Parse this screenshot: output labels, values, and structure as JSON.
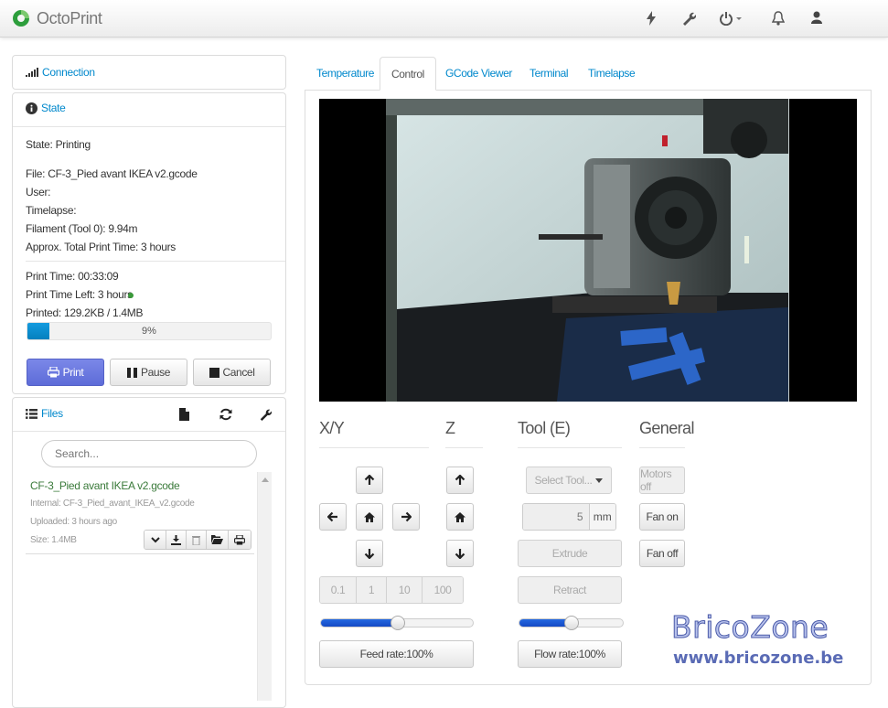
{
  "app": {
    "title": "OctoPrint"
  },
  "navbar": {
    "icons": [
      "lightning-icon",
      "wrench-icon",
      "power-icon",
      "bell-icon",
      "user-icon"
    ]
  },
  "connection": {
    "title": "Connection"
  },
  "state": {
    "title": "State",
    "status": "State: Printing",
    "file": "File: CF-3_Pied avant IKEA v2.gcode",
    "user": "User:",
    "timelapse": "Timelapse:",
    "filament": "Filament (Tool 0): 9.94m",
    "approx_time": "Approx. Total Print Time: 3 hours",
    "print_time": "Print Time: 00:33:09",
    "time_left": "Print Time Left: 3 hours",
    "printed": "Printed: 129.2KB / 1.4MB",
    "progress_label": "9%",
    "progress": 0.09,
    "buttons": {
      "print": "Print",
      "pause": "Pause",
      "cancel": "Cancel"
    }
  },
  "files": {
    "title": "Files",
    "search_placeholder": "Search...",
    "item": {
      "name": "CF-3_Pied avant IKEA v2.gcode",
      "internal": "Internal: CF-3_Pied_avant_IKEA_v2.gcode",
      "uploaded": "Uploaded: 3 hours ago",
      "size": "Size: 1.4MB"
    }
  },
  "tabs": [
    "Temperature",
    "Control",
    "GCode Viewer",
    "Terminal",
    "Timelapse"
  ],
  "active_tab": "Control",
  "control": {
    "xy_title": "X/Y",
    "z_title": "Z",
    "tool_title": "Tool (E)",
    "general_title": "General",
    "steps": [
      "0.1",
      "1",
      "10",
      "100"
    ],
    "select_tool": "Select Tool...",
    "extrude_amount": "5",
    "extrude_unit": "mm",
    "extrude": "Extrude",
    "retract": "Retract",
    "motors_off": "Motors off",
    "fan_on": "Fan on",
    "fan_off": "Fan off",
    "feed_rate": "Feed rate:100%",
    "flow_rate": "Flow rate:100%",
    "feed_level": 0.5,
    "flow_level": 0.5
  },
  "watermark": {
    "name": "BricoZone",
    "url": "www.bricozone.be"
  },
  "colors": {
    "link": "#0088cc",
    "primary": "#5d6cd8",
    "progress": "#149bdf",
    "status_dot": "#3a9a3a"
  }
}
